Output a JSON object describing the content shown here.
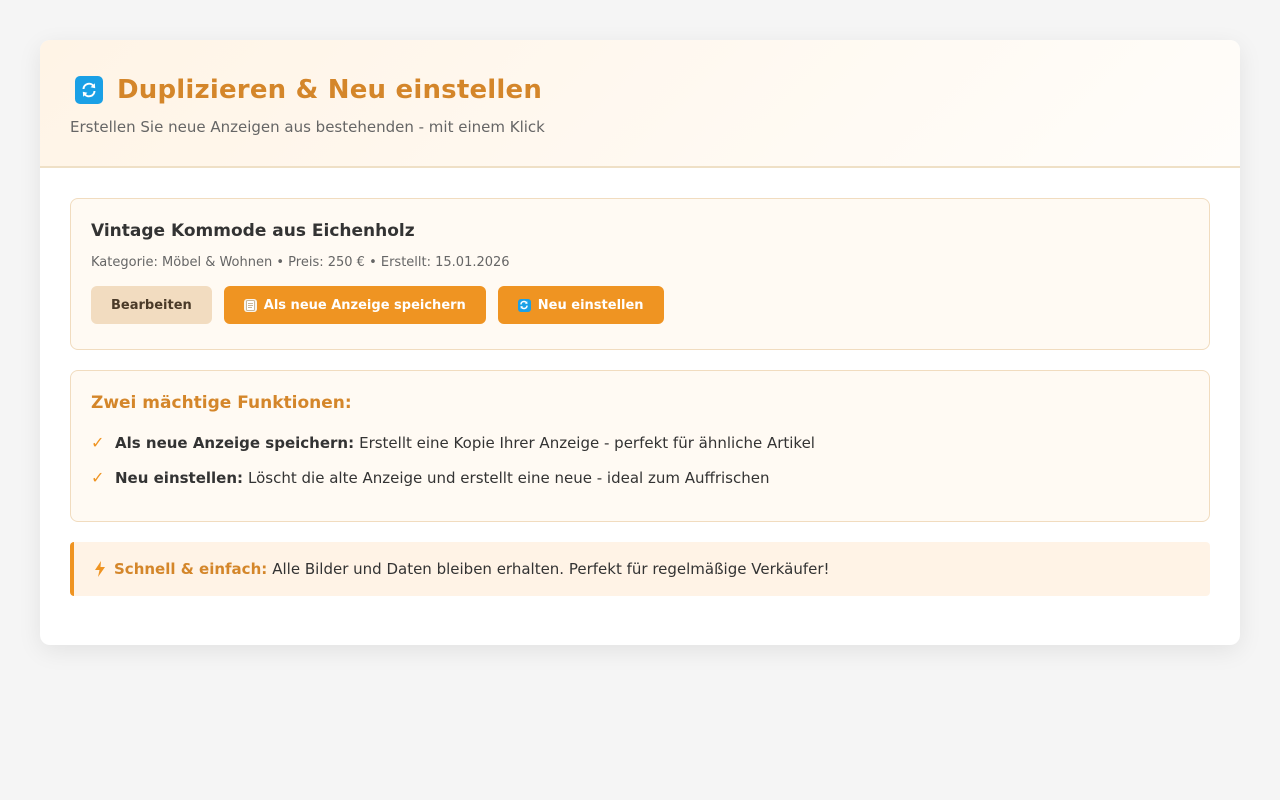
{
  "header": {
    "title": "Duplizieren & Neu einstellen",
    "subtitle": "Erstellen Sie neue Anzeigen aus bestehenden - mit einem Klick",
    "icon": "refresh-icon"
  },
  "ad": {
    "title": "Vintage Kommode aus Eichenholz",
    "meta": "Kategorie: Möbel & Wohnen • Preis: 250 € • Erstellt: 15.01.2026",
    "buttons": {
      "edit": "Bearbeiten",
      "save_new": "Als neue Anzeige speichern",
      "repost": "Neu einstellen"
    }
  },
  "features": {
    "title": "Zwei mächtige Funktionen:",
    "items": [
      {
        "label": "Als neue Anzeige speichern:",
        "text": "Erstellt eine Kopie Ihrer Anzeige - perfekt für ähnliche Artikel"
      },
      {
        "label": "Neu einstellen:",
        "text": "Löscht die alte Anzeige und erstellt eine neue - ideal zum Auffrischen"
      }
    ]
  },
  "tip": {
    "label": "Schnell & einfach:",
    "text": "Alle Bilder und Daten bleiben erhalten. Perfekt für regelmäßige Verkäufer!"
  },
  "colors": {
    "accent": "#ef9422",
    "title": "#d4862a",
    "icon_blue": "#1aa0e6",
    "secondary_button": "#f2dcc0"
  }
}
